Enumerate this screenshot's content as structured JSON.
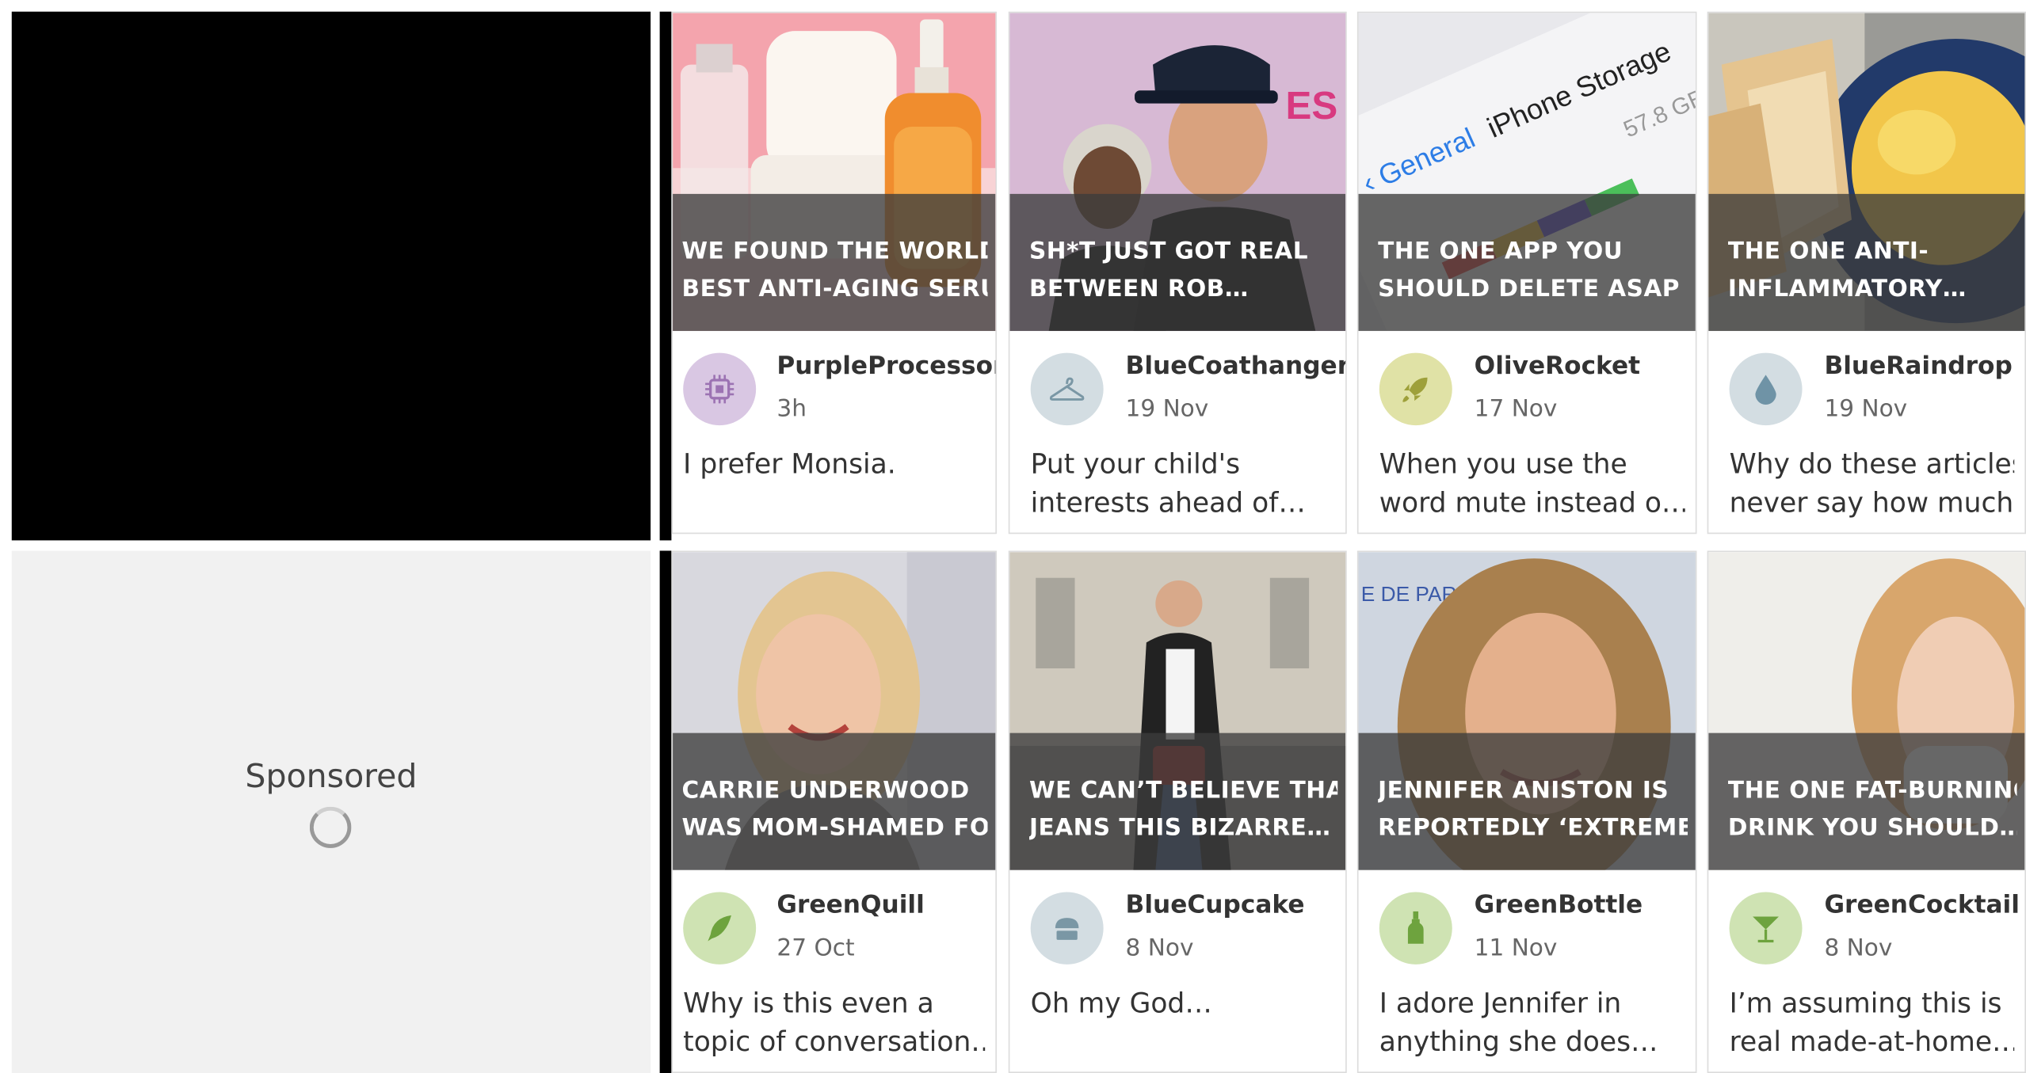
{
  "sponsored": {
    "label": "Sponsored"
  },
  "cards": [
    {
      "headline_lines": [
        "WE FOUND THE WORLD’S",
        "BEST ANTI-AGING SERU…"
      ],
      "user": "PurpleProcessor",
      "time": "3h",
      "comment_lines": [
        "I prefer Monsia.",
        ""
      ],
      "avatar_icon": "processor-icon",
      "avatar_color": "#d9c7e3",
      "icon_color": "#9c73b3"
    },
    {
      "headline_lines": [
        "SH*T JUST GOT REAL",
        "BETWEEN ROB…"
      ],
      "user": "BlueCoathanger",
      "time": "19 Nov",
      "comment_lines": [
        "Put your child's",
        "interests ahead of…"
      ],
      "avatar_icon": "coathanger-icon",
      "avatar_color": "#d3dde2",
      "icon_color": "#7a97a5"
    },
    {
      "headline_lines": [
        "THE ONE APP YOU",
        "SHOULD DELETE ASAP I…"
      ],
      "user": "OliveRocket",
      "time": "17 Nov",
      "comment_lines": [
        "When you use the",
        "word mute instead o…"
      ],
      "avatar_icon": "rocket-icon",
      "avatar_color": "#e0e2a6",
      "icon_color": "#9ea03a"
    },
    {
      "headline_lines": [
        "THE ONE ANTI-",
        "INFLAMMATORY…"
      ],
      "user": "BlueRaindrop",
      "time": "19 Nov",
      "comment_lines": [
        "Why do these articles",
        "never say how much…"
      ],
      "avatar_icon": "raindrop-icon",
      "avatar_color": "#d3dde2",
      "icon_color": "#6f93a6"
    },
    {
      "headline_lines": [
        "CARRIE UNDERWOOD",
        "WAS MOM-SHAMED FO…"
      ],
      "user": "GreenQuill",
      "time": "27 Oct",
      "comment_lines": [
        "Why is this even a",
        "topic of conversation…"
      ],
      "avatar_icon": "quill-icon",
      "avatar_color": "#cfe3b3",
      "icon_color": "#6ea33e"
    },
    {
      "headline_lines": [
        "WE CAN’T BELIEVE THAT",
        "JEANS THIS BIZARRE…"
      ],
      "user": "BlueCupcake",
      "time": "8 Nov",
      "comment_lines": [
        "Oh my God…",
        ""
      ],
      "avatar_icon": "cupcake-icon",
      "avatar_color": "#d3dde2",
      "icon_color": "#7a97a5"
    },
    {
      "headline_lines": [
        "JENNIFER ANISTON IS",
        "REPORTEDLY ‘EXTREME…"
      ],
      "user": "GreenBottle",
      "time": "11 Nov",
      "comment_lines": [
        "I adore Jennifer in",
        "anything she does…"
      ],
      "avatar_icon": "bottle-icon",
      "avatar_color": "#cfe3b3",
      "icon_color": "#6ea33e"
    },
    {
      "headline_lines": [
        "THE ONE FAT-BURNING",
        "DRINK YOU SHOULD…"
      ],
      "user": "GreenCocktail",
      "time": "8 Nov",
      "comment_lines": [
        "I’m assuming this is",
        "real made-at-home…"
      ],
      "avatar_icon": "cocktail-icon",
      "avatar_color": "#cfe3b3",
      "icon_color": "#6ea33e"
    }
  ]
}
